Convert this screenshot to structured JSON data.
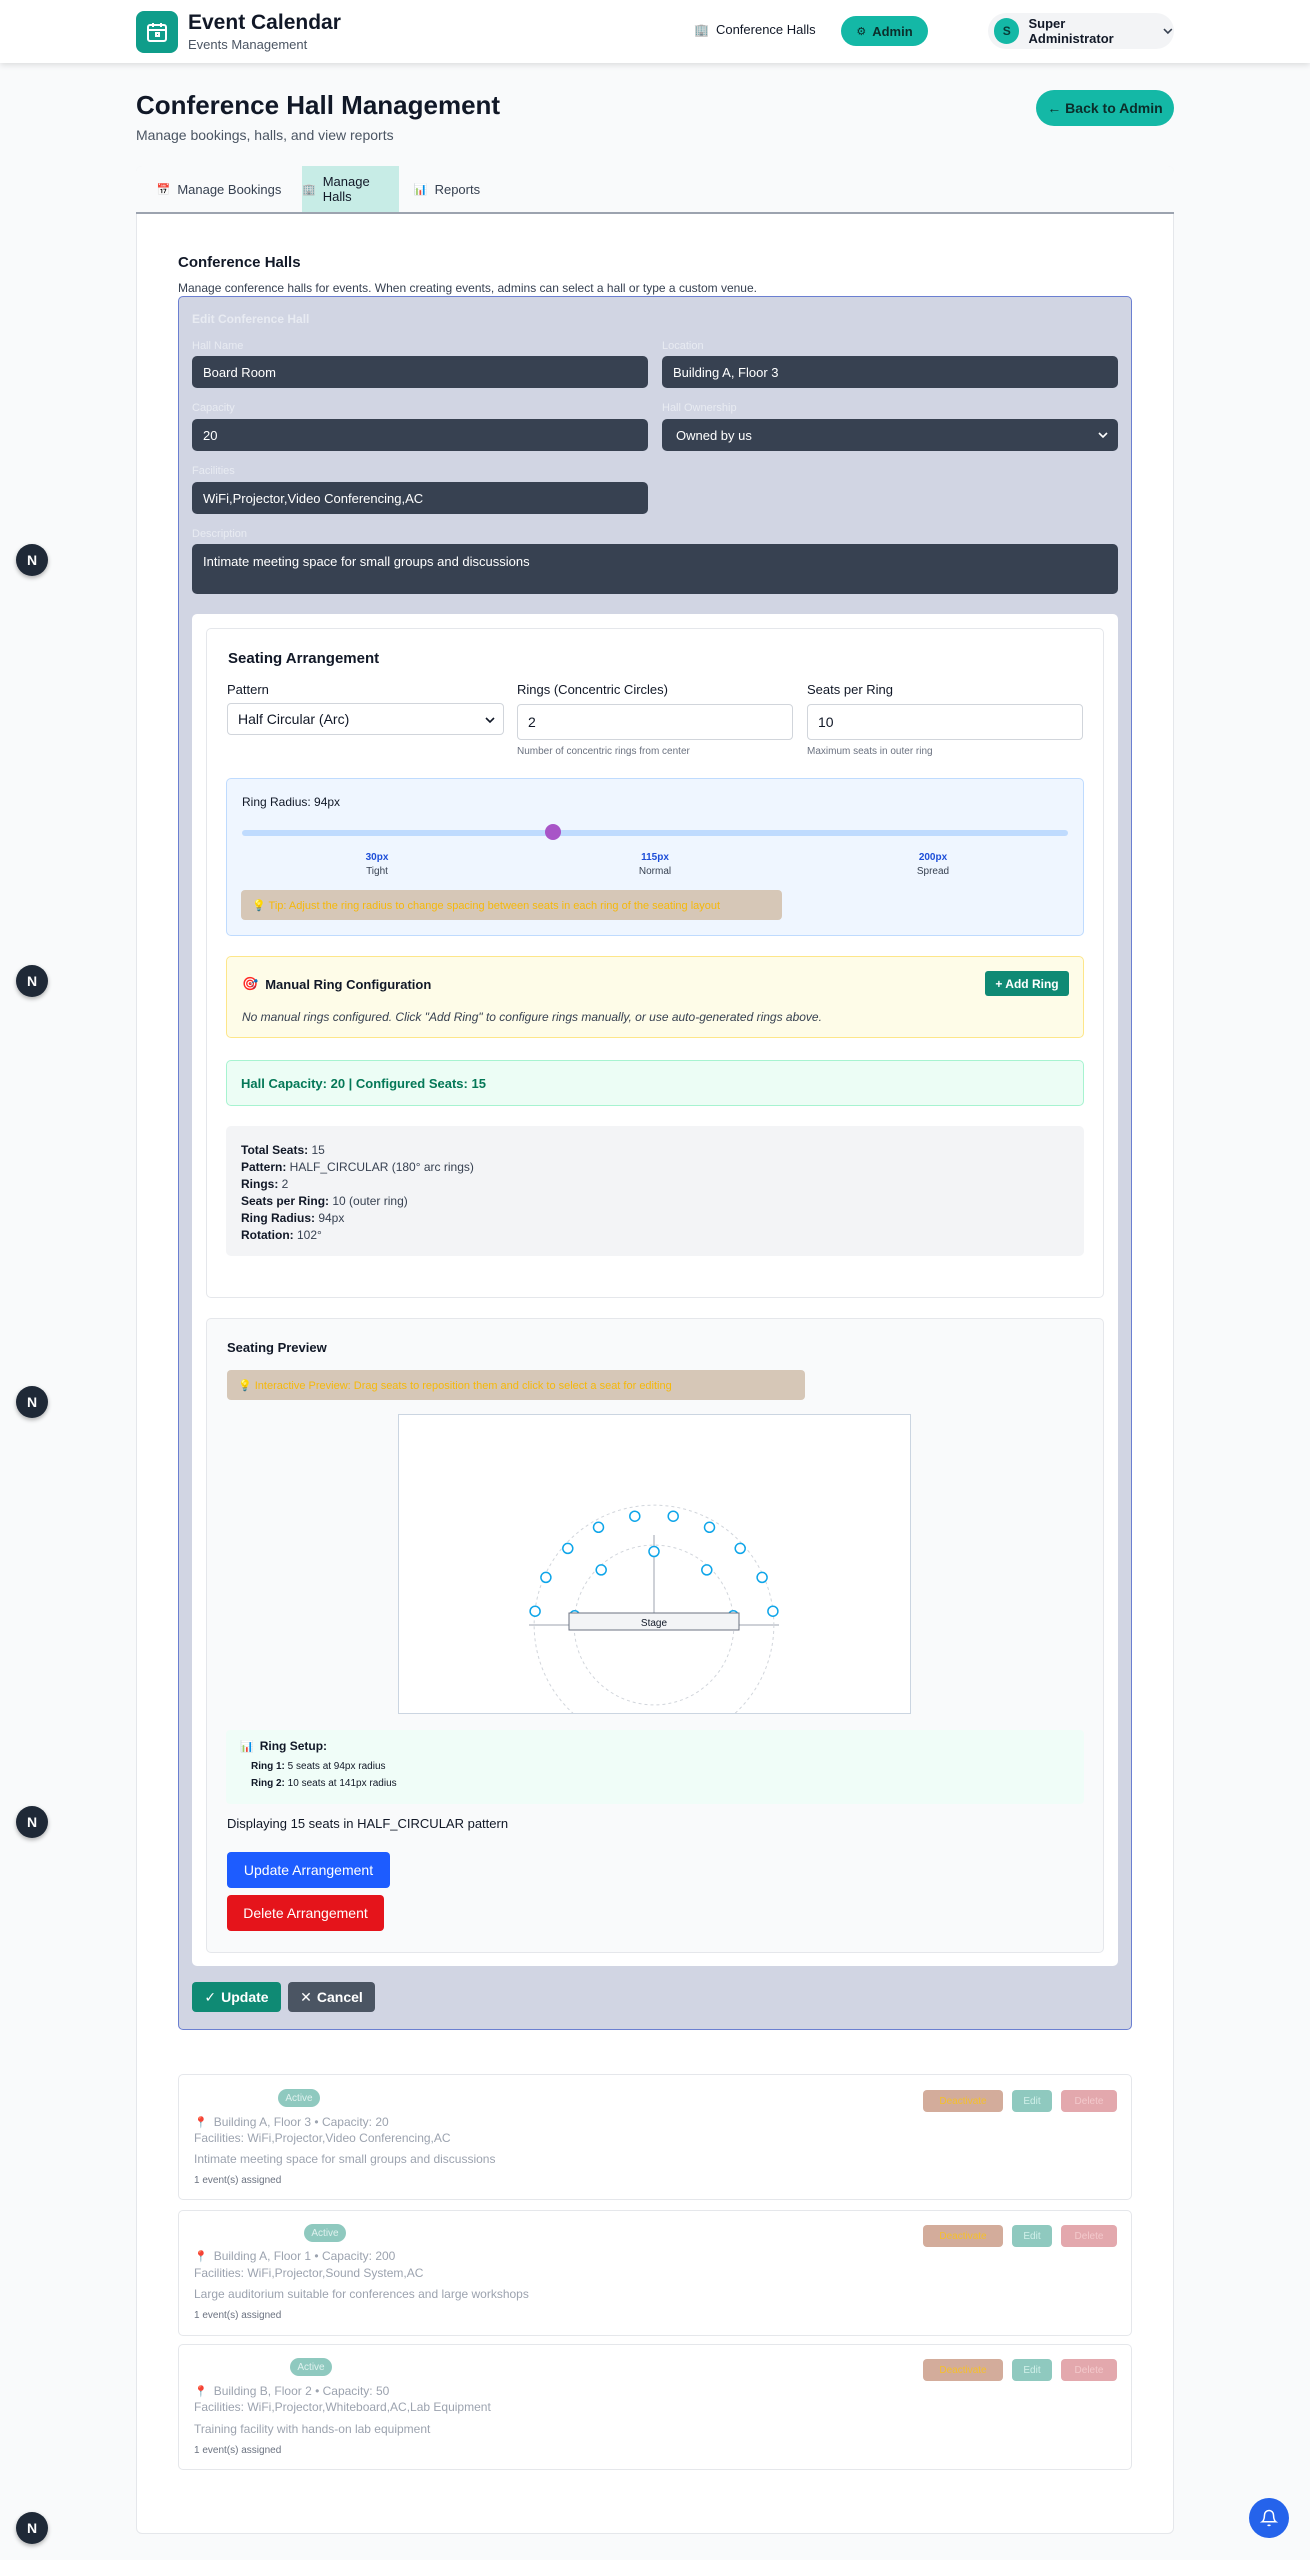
{
  "header": {
    "app_title": "Event Calendar",
    "app_subtitle": "Events Management",
    "nav_halls": "Conference Halls",
    "nav_admin": "Admin",
    "user_initial": "S",
    "user_name": "Super Administrator"
  },
  "page": {
    "title": "Conference Hall Management",
    "subtitle": "Manage bookings, halls, and view reports",
    "back_button": "← Back to Admin"
  },
  "tabs": [
    {
      "label": "Manage Bookings",
      "active": false
    },
    {
      "label": "Manage Halls",
      "active": true
    },
    {
      "label": "Reports",
      "active": false
    }
  ],
  "section": {
    "title": "Conference Halls",
    "description": "Manage conference halls for events. When creating events, admins can select a hall or type a custom venue."
  },
  "edit_form": {
    "heading": "Edit Conference Hall",
    "name_label": "Hall Name",
    "name_value": "Board Room",
    "location_label": "Location",
    "location_value": "Building A, Floor 3",
    "capacity_label": "Capacity",
    "capacity_value": "20",
    "ownership_label": "Hall Ownership",
    "ownership_value": "Owned by us",
    "facilities_label": "Facilities",
    "facilities_value": "WiFi,Projector,Video Conferencing,AC",
    "description_label": "Description",
    "description_value": "Intimate meeting space for small groups and discussions"
  },
  "seating": {
    "title": "Seating Arrangement",
    "pattern_label": "Pattern",
    "pattern_value": "Half Circular (Arc)",
    "rings_label": "Rings (Concentric Circles)",
    "rings_value": "2",
    "rings_hint": "Number of concentric rings from center",
    "seats_label": "Seats per Ring",
    "seats_value": "10",
    "seats_hint": "Maximum seats in outer ring",
    "radius_label": "Ring Radius: 94px",
    "radius_min": 30,
    "radius_max": 200,
    "radius_value": 94,
    "ticks": [
      {
        "value": "30px",
        "name": "Tight"
      },
      {
        "value": "115px",
        "name": "Normal"
      },
      {
        "value": "200px",
        "name": "Spread"
      }
    ],
    "radius_tip": "💡 Tip: Adjust the ring radius to change spacing between seats in each ring of the seating layout"
  },
  "manual": {
    "title": "Manual Ring Configuration",
    "add_button": "+ Add Ring",
    "empty_text": "No manual rings configured. Click \"Add Ring\" to configure rings manually, or use auto-generated rings above."
  },
  "capacity_line": "Hall Capacity: 20 | Configured Seats: 15",
  "summary": [
    {
      "key": "Total Seats:",
      "value": " 15"
    },
    {
      "key": "Pattern:",
      "value": " HALF_CIRCULAR (180° arc rings)"
    },
    {
      "key": "Rings:",
      "value": " 2"
    },
    {
      "key": "Seats per Ring:",
      "value": " 10 (outer ring)"
    },
    {
      "key": "Ring Radius:",
      "value": " 94px"
    },
    {
      "key": "Rotation:",
      "value": " 102°"
    }
  ],
  "preview": {
    "title": "Seating Preview",
    "note": "💡 Interactive Preview: Drag seats to reposition them and click to select a seat for editing",
    "stage_label": "Stage",
    "ring_setup_title": "Ring Setup:",
    "ring_lines": [
      {
        "key": "Ring 1:",
        "value": " 5 seats at 94px radius"
      },
      {
        "key": "Ring 2:",
        "value": " 10 seats at 141px radius"
      }
    ],
    "display_text": "Displaying 15 seats in HALF_CIRCULAR pattern",
    "update_button": "Update Arrangement",
    "delete_button": "Delete Arrangement"
  },
  "form_actions": {
    "update": "Update",
    "cancel": "Cancel"
  },
  "halls": [
    {
      "status": "Active",
      "location": "Building A, Floor 3 • Capacity: 20",
      "facilities": "Facilities: WiFi,Projector,Video Conferencing,AC",
      "description": "Intimate meeting space for small groups and discussions",
      "events": "1 event(s) assigned",
      "deactivate": "Deactivate",
      "edit": "Edit",
      "delete": "Delete"
    },
    {
      "status": "Active",
      "location": "Building A, Floor 1 • Capacity: 200",
      "facilities": "Facilities: WiFi,Projector,Sound System,AC",
      "description": "Large auditorium suitable for conferences and large workshops",
      "events": "1 event(s) assigned",
      "deactivate": "Deactivate",
      "edit": "Edit",
      "delete": "Delete"
    },
    {
      "status": "Active",
      "location": "Building B, Floor 2 • Capacity: 50",
      "facilities": "Facilities: WiFi,Projector,Whiteboard,AC,Lab Equipment",
      "description": "Training facility with hands-on lab equipment",
      "events": "1 event(s) assigned",
      "deactivate": "Deactivate",
      "edit": "Edit",
      "delete": "Delete"
    }
  ],
  "dev_badge": "N",
  "colors": {
    "teal": "#14b8a6",
    "dark_teal": "#0f8a74",
    "blue": "#1d5cff",
    "red": "#e5141b",
    "seat_stroke": "#0ea5e9"
  }
}
